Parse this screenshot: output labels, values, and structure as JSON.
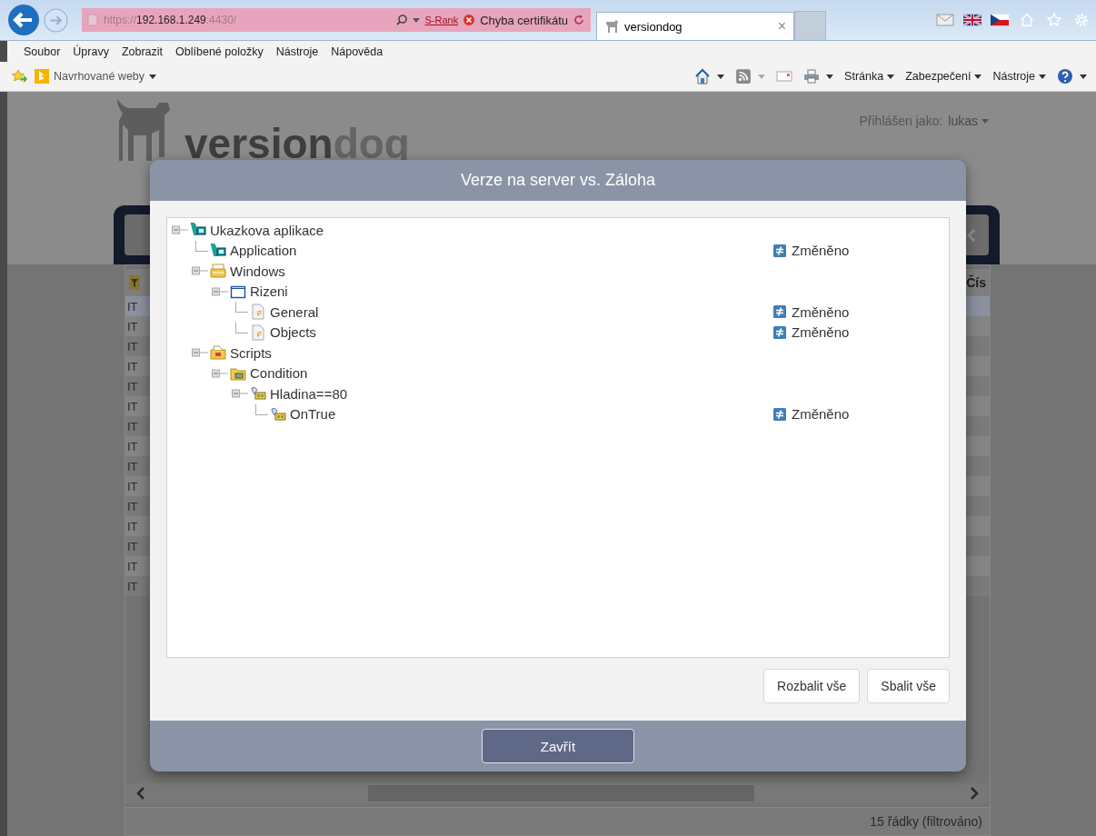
{
  "browser": {
    "url": {
      "scheme": "https://",
      "host": "192.168.1.249",
      "port": ":4430/"
    },
    "rank_link": "S-Rank",
    "cert_error": "Chyba certifikátu",
    "tab": {
      "title": "versiondog",
      "close": "×"
    }
  },
  "menu": [
    "Soubor",
    "Úpravy",
    "Zobrazit",
    "Oblíbené položky",
    "Nástroje",
    "Nápověda"
  ],
  "favorites": {
    "suggested": "Navrhované weby"
  },
  "command_bar": [
    "Stránka",
    "Zabezpečení",
    "Nástroje"
  ],
  "page": {
    "logo": {
      "main": "version",
      "accent": "dog"
    },
    "login_label": "Přihlášen jako:",
    "user": "lukas",
    "table": {
      "column_2": "Čís",
      "rows": [
        {
          "cell": "IT",
          "selected": true
        },
        {
          "cell": "IT",
          "selected": false
        },
        {
          "cell": "IT",
          "selected": false
        },
        {
          "cell": "IT",
          "selected": false
        },
        {
          "cell": "IT",
          "selected": false
        },
        {
          "cell": "IT",
          "selected": false
        },
        {
          "cell": "IT",
          "selected": false
        },
        {
          "cell": "IT",
          "selected": false
        },
        {
          "cell": "IT",
          "selected": false
        },
        {
          "cell": "IT",
          "selected": false
        },
        {
          "cell": "IT",
          "selected": false
        },
        {
          "cell": "IT",
          "selected": false
        },
        {
          "cell": "IT",
          "selected": false
        },
        {
          "cell": "IT",
          "selected": false
        },
        {
          "cell": "IT",
          "selected": false
        }
      ]
    },
    "status": "15 řádky (filtrováno)"
  },
  "dialog": {
    "title": "Verze na server vs. Záloha",
    "tree": [
      {
        "label": "Ukazkova aplikace",
        "kind": "app",
        "expanded": true,
        "children": [
          {
            "label": "Application",
            "kind": "app",
            "status": "Změněno"
          },
          {
            "label": "Windows",
            "kind": "windows",
            "expanded": true,
            "children": [
              {
                "label": "Rizeni",
                "kind": "form",
                "expanded": true,
                "children": [
                  {
                    "label": "General",
                    "kind": "page",
                    "status": "Změněno"
                  },
                  {
                    "label": "Objects",
                    "kind": "page",
                    "status": "Změněno"
                  }
                ]
              }
            ]
          },
          {
            "label": "Scripts",
            "kind": "scripts",
            "expanded": true,
            "children": [
              {
                "label": "Condition",
                "kind": "folder",
                "expanded": true,
                "children": [
                  {
                    "label": "Hladina==80",
                    "kind": "script",
                    "expanded": true,
                    "children": [
                      {
                        "label": "OnTrue",
                        "kind": "script",
                        "status": "Změněno"
                      }
                    ]
                  }
                ]
              }
            ]
          }
        ]
      }
    ],
    "buttons": [
      "Rozbalit vše",
      "Sbalit vše"
    ],
    "close": "Zavřít"
  }
}
